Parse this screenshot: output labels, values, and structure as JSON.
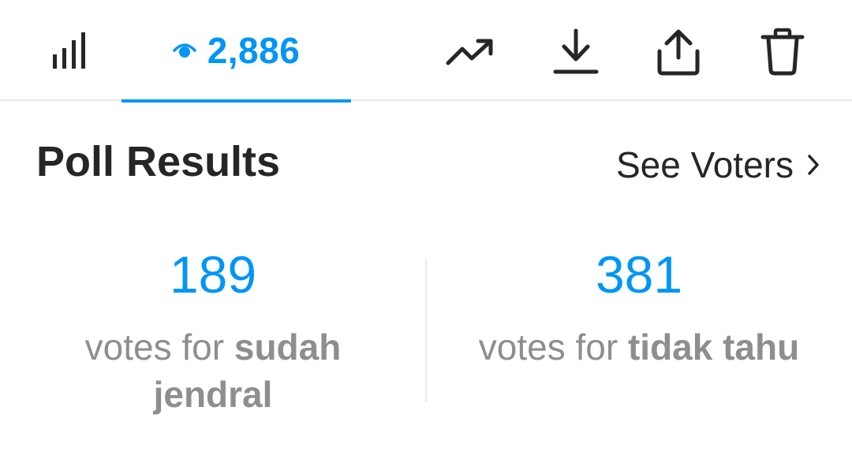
{
  "toolbar": {
    "insights_icon": "bar-chart-icon",
    "viewer_icon": "eye-icon",
    "viewer_count": "2,886",
    "promote_icon": "trend-up-icon",
    "download_icon": "download-icon",
    "share_icon": "share-icon",
    "delete_icon": "trash-icon",
    "accent_color": "#0095f6"
  },
  "poll": {
    "title": "Poll Results",
    "see_voters_label": "See Voters",
    "options": [
      {
        "count": "189",
        "prefix": "votes for ",
        "name": "sudah jendral"
      },
      {
        "count": "381",
        "prefix": "votes for ",
        "name": "tidak tahu"
      }
    ]
  }
}
